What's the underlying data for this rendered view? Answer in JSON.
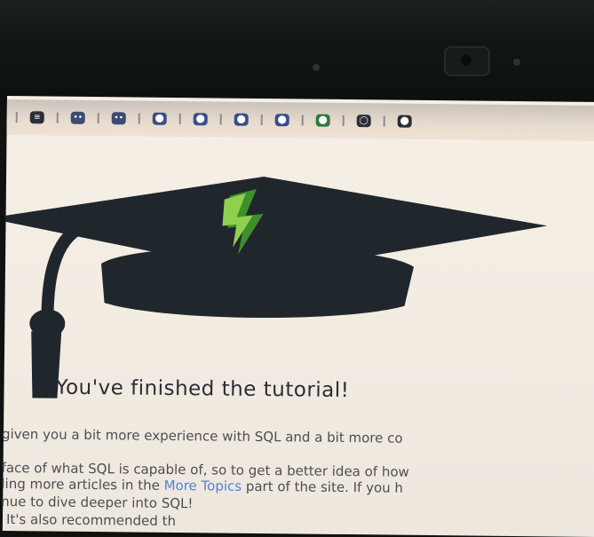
{
  "toolbar": {
    "icons": [
      {
        "name": "list-icon",
        "glyph": "≡"
      },
      {
        "name": "chat-icon",
        "glyph": "••"
      },
      {
        "name": "chat-icon-2",
        "glyph": "••"
      },
      {
        "name": "extension-icon-1",
        "glyph": "⬤"
      },
      {
        "name": "extension-icon-2",
        "glyph": "⬤"
      },
      {
        "name": "extension-icon-3",
        "glyph": "⬤"
      },
      {
        "name": "extension-icon-4",
        "glyph": "⬤"
      },
      {
        "name": "extension-icon-5",
        "glyph": "⬤"
      },
      {
        "name": "github-icon",
        "glyph": "◯"
      },
      {
        "name": "more-icon",
        "glyph": "⬤"
      }
    ]
  },
  "heading": "You've finished the tutorial!",
  "paragraphs": {
    "line1": "given you a bit more experience with SQL and a bit more co",
    "line2": "face of what SQL is capable of, so to get a better idea of how",
    "line3_prefix": "ling more articles in the ",
    "line3_link": "More Topics",
    "line3_suffix": " part of the site. If you h",
    "line4": "nue to dive deeper into SQL!",
    "line5": "It's also recommended th"
  },
  "colors": {
    "cap": "#20272c",
    "bolt_light": "#8fd14f",
    "bolt_dark": "#3f8f2a",
    "link": "#4f84d6"
  }
}
